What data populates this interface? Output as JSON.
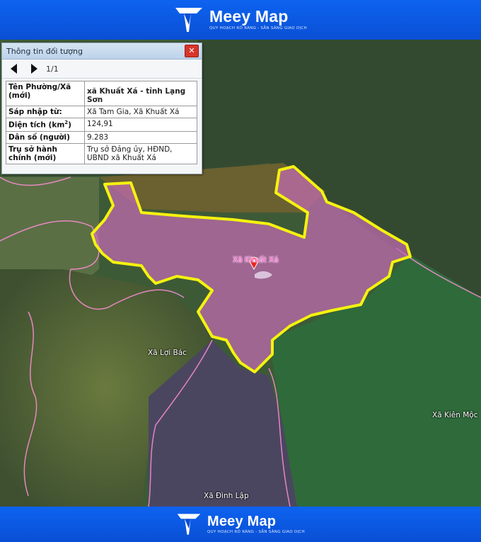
{
  "header": {
    "brand": "Meey Map",
    "tagline": "QUY HOẠCH RÕ RÀNG - SẴN SÀNG GIAO DỊCH"
  },
  "footer": {
    "brand": "Meey Map",
    "tagline": "QUY HOẠCH RÕ RÀNG - SẴN SÀNG GIAO DỊCH"
  },
  "info_panel": {
    "title": "Thông tin đối tượng",
    "close_label": "✕",
    "pager": "1/1",
    "rows": [
      {
        "key": "Tên Phường/Xã (mới)",
        "value": "xã Khuất Xá - tỉnh Lạng Sơn"
      },
      {
        "key": "Sáp nhập từ:",
        "value": "Xã Tam Gia, Xã Khuất Xá"
      },
      {
        "key_prefix": "Diện tích (km",
        "key_sup": "2",
        "key_suffix": ")",
        "value": "124,91"
      },
      {
        "key": "Dân số (người)",
        "value": "9.283"
      },
      {
        "key": "Trụ sở hành chính (mới)",
        "value": "Trụ sở Đảng ủy, HĐND, UBND xã Khuất Xá"
      }
    ]
  },
  "map": {
    "labels": {
      "khuat_xa": "Xã Khuất Xá",
      "loi_bac": "Xã Lợi Bác",
      "kien_moc": "Xã Kiên Mộc",
      "dinh_lap": "Xã Đình Lập"
    },
    "colors": {
      "highlight_border": "#f5f20f",
      "highlight_fill": "#c46bb4",
      "district_line": "#ff8fd6",
      "marker": "#e8261e"
    }
  }
}
